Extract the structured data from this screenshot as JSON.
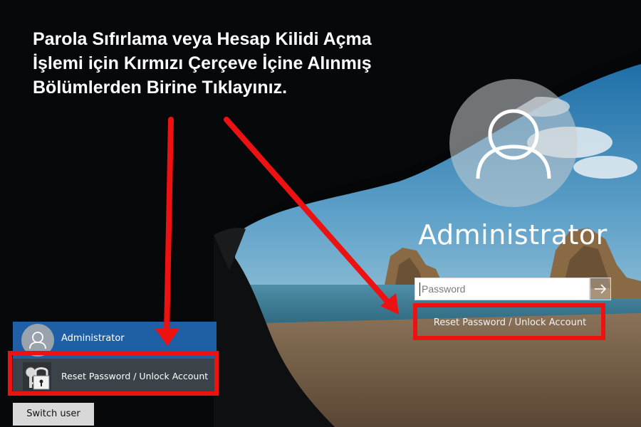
{
  "instruction": {
    "line1": "Parola Sıfırlama veya Hesap Kilidi Açma",
    "line2": "İşlemi için  Kırmızı Çerçeve İçine Alınmış",
    "line3": "Bölümlerden Birine Tıklayınız."
  },
  "login": {
    "username": "Administrator",
    "password_placeholder": "Password",
    "submit_icon": "arrow-right-icon",
    "reset_link": "Reset Password / Unlock Account"
  },
  "side_panel": {
    "user_name": "Administrator",
    "reset_label": "Reset Password / Unlock Account",
    "switch_user_label": "Switch user"
  },
  "colors": {
    "highlight_red": "#ee1111",
    "user_panel_blue": "#1f5fa6"
  }
}
